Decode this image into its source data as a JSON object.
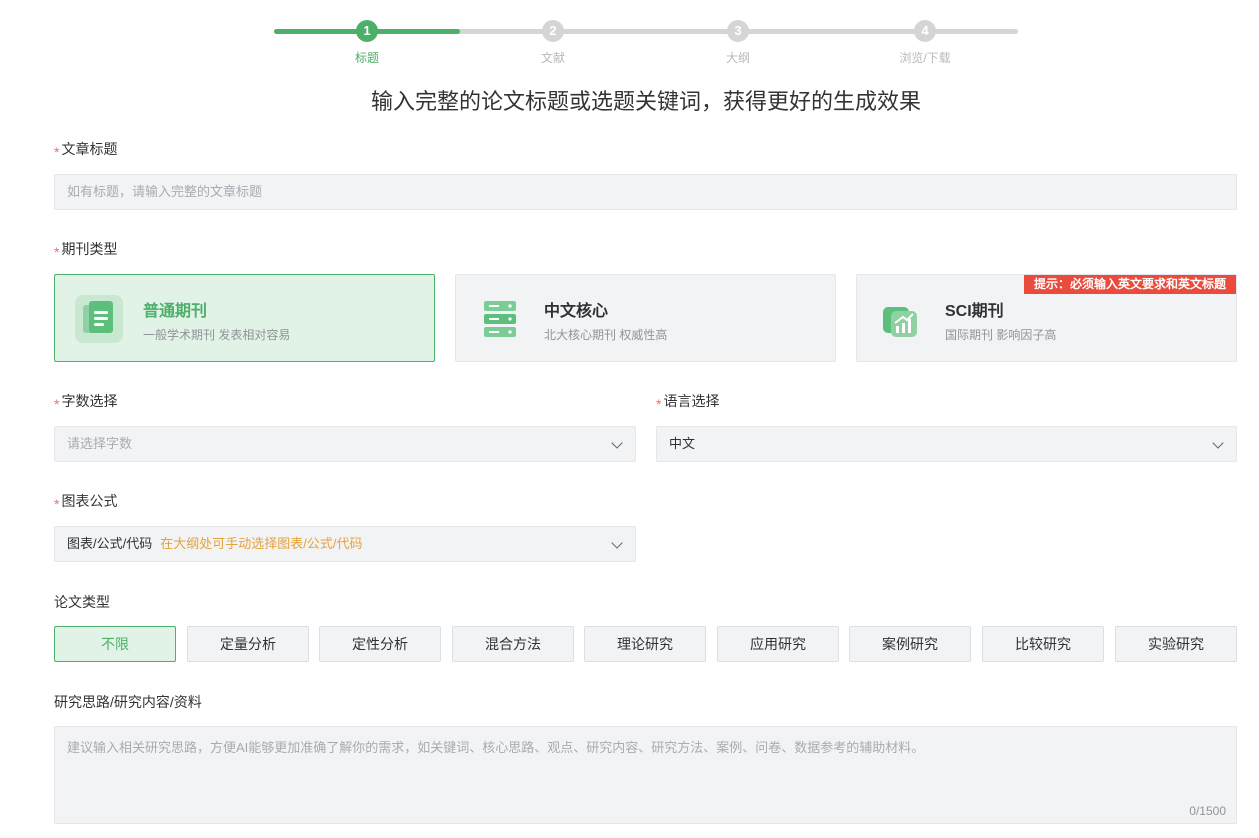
{
  "stepper": {
    "steps": [
      {
        "num": "1",
        "label": "标题"
      },
      {
        "num": "2",
        "label": "文献"
      },
      {
        "num": "3",
        "label": "大纲"
      },
      {
        "num": "4",
        "label": "浏览/下载"
      }
    ],
    "active_step": 1
  },
  "headline": "输入完整的论文标题或选题关键词，获得更好的生成效果",
  "title_field": {
    "label": "文章标题",
    "placeholder": "如有标题，请输入完整的文章标题"
  },
  "journal_type": {
    "label": "期刊类型",
    "cards": [
      {
        "title": "普通期刊",
        "desc": "一般学术期刊 发表相对容易",
        "icon": "document-stack-icon",
        "selected": true
      },
      {
        "title": "中文核心",
        "desc": "北大核心期刊 权威性高",
        "icon": "server-stack-icon",
        "selected": false
      },
      {
        "title": "SCI期刊",
        "desc": "国际期刊 影响因子高",
        "icon": "growth-chart-icon",
        "selected": false,
        "tip": "提示：必须输入英文要求和英文标题"
      }
    ]
  },
  "word_count": {
    "label": "字数选择",
    "placeholder": "请选择字数"
  },
  "language": {
    "label": "语言选择",
    "value": "中文"
  },
  "charts_formula": {
    "label": "图表公式",
    "value": "图表/公式/代码",
    "hint": "在大纲处可手动选择图表/公式/代码"
  },
  "paper_type": {
    "label": "论文类型",
    "options": [
      "不限",
      "定量分析",
      "定性分析",
      "混合方法",
      "理论研究",
      "应用研究",
      "案例研究",
      "比较研究",
      "实验研究"
    ],
    "selected_index": 0
  },
  "research": {
    "label": "研究思路/研究内容/资料",
    "placeholder": "建议输入相关研究思路，方便AI能够更加准确了解你的需求，如关键词、核心思路、观点、研究内容、研究方法、案例、问卷、数据参考的辅助材料。",
    "counter": "0/1500"
  },
  "colors": {
    "accent": "#4caf6a",
    "accent_bg": "#e1f3e6",
    "required": "#f56c6c",
    "tip_bg": "#e94b3c",
    "hint": "#e6a23c"
  }
}
